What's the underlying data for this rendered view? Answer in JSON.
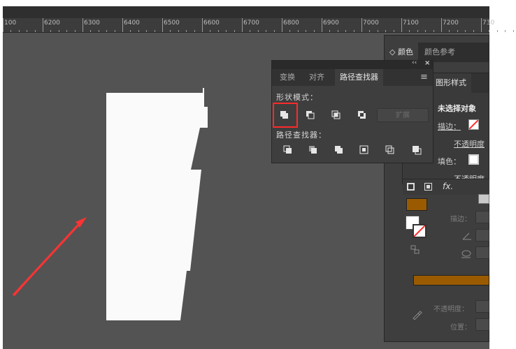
{
  "ruler": {
    "labels": [
      "100",
      "6200",
      "6300",
      "6400",
      "6500",
      "6600",
      "6700",
      "6800",
      "6900",
      "7000",
      "7100",
      "7200",
      "730"
    ]
  },
  "color_panel": {
    "tabs": [
      "◇ 颜色",
      "颜色参考"
    ],
    "opacity_label": "不透明度：",
    "position_label": "位置：",
    "stroke_label": "描边：",
    "fill_color": "#9a5b00",
    "gradient_color": "#9a5b00"
  },
  "appearance_panel": {
    "tab": "图形样式",
    "no_selection": "未选择对象",
    "stroke_label": "描边：",
    "opacity_label": "不透明度",
    "fill_label": "填色：",
    "opacity_label_2": "不透明度",
    "fx_label": "fx."
  },
  "pathfinder_panel": {
    "collapse_glyph": "‹‹",
    "close_glyph": "×",
    "tabs": [
      "变换",
      "对齐",
      "路径查找器"
    ],
    "menu_glyph": "≡",
    "shape_modes_label": "形状模式：",
    "expand_label": "扩展",
    "pathfinders_label": "路径查找器：",
    "highlight_color": "#ff2a2a"
  },
  "annotation": {
    "arrow_color": "#ff3333"
  }
}
